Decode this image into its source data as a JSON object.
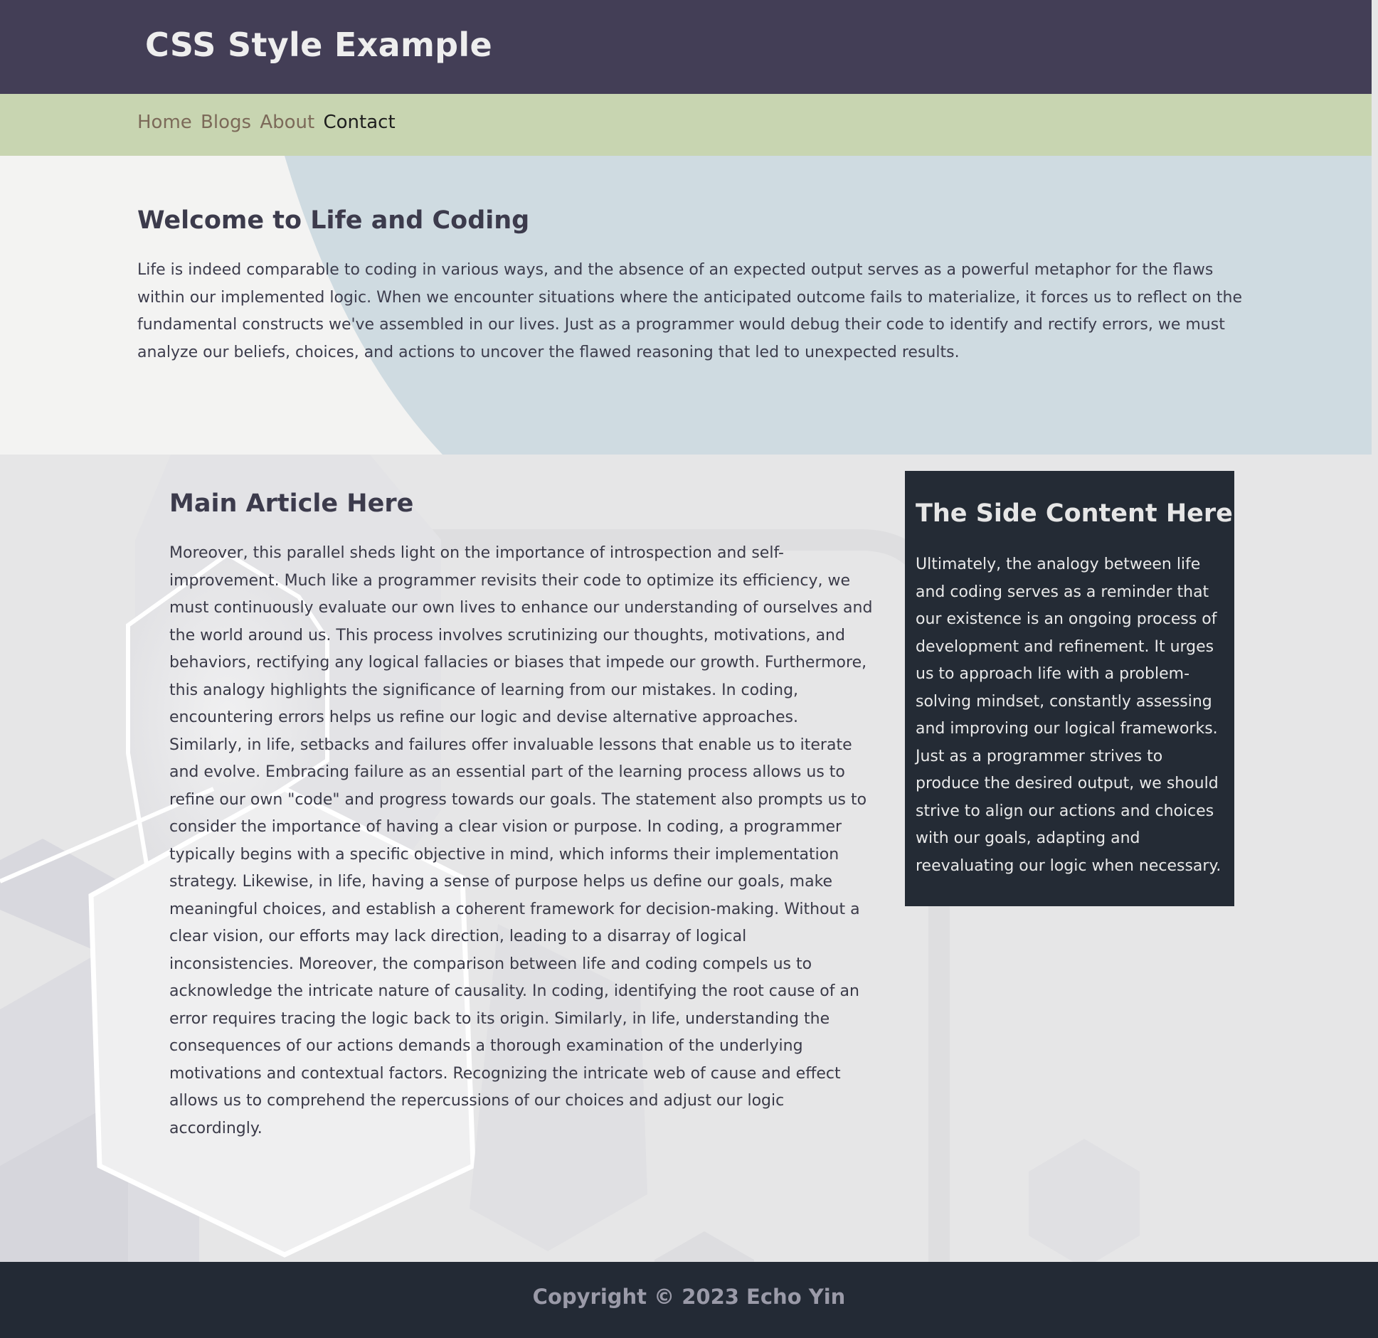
{
  "header": {
    "title": "CSS Style Example"
  },
  "nav": {
    "items": [
      "Home",
      "Blogs",
      "About",
      "Contact"
    ],
    "active": "Contact"
  },
  "hero": {
    "title": "Welcome to Life and Coding",
    "text": "Life is indeed comparable to coding in various ways, and the absence of an expected output serves as a powerful metaphor for the flaws within our implemented logic. When we encounter situations where the anticipated outcome fails to materialize, it forces us to reflect on the fundamental constructs we've assembled in our lives. Just as a programmer would debug their code to identify and rectify errors, we must analyze our beliefs, choices, and actions to uncover the flawed reasoning that led to unexpected results."
  },
  "main": {
    "title": "Main Article Here",
    "text": "Moreover, this parallel sheds light on the importance of introspection and self-improvement. Much like a programmer revisits their code to optimize its efficiency, we must continuously evaluate our own lives to enhance our understanding of ourselves and the world around us. This process involves scrutinizing our thoughts, motivations, and behaviors, rectifying any logical fallacies or biases that impede our growth. Furthermore, this analogy highlights the significance of learning from our mistakes. In coding, encountering errors helps us refine our logic and devise alternative approaches. Similarly, in life, setbacks and failures offer invaluable lessons that enable us to iterate and evolve. Embracing failure as an essential part of the learning process allows us to refine our own \"code\" and progress towards our goals. The statement also prompts us to consider the importance of having a clear vision or purpose. In coding, a programmer typically begins with a specific objective in mind, which informs their implementation strategy. Likewise, in life, having a sense of purpose helps us define our goals, make meaningful choices, and establish a coherent framework for decision-making. Without a clear vision, our efforts may lack direction, leading to a disarray of logical inconsistencies. Moreover, the comparison between life and coding compels us to acknowledge the intricate nature of causality. In coding, identifying the root cause of an error requires tracing the logic back to its origin. Similarly, in life, understanding the consequences of our actions demands a thorough examination of the underlying motivations and contextual factors. Recognizing the intricate web of cause and effect allows us to comprehend the repercussions of our choices and adjust our logic accordingly."
  },
  "aside": {
    "title": "The Side Content Here",
    "text": "Ultimately, the analogy between life and coding serves as a reminder that our existence is an ongoing process of development and refinement. It urges us to approach life with a problem-solving mindset, constantly assessing and improving our logical frameworks. Just as a programmer strives to produce the desired output, we should strive to align our actions and choices with our goals, adapting and reevaluating our logic when necessary."
  },
  "footer": {
    "copyright": "Copyright © 2023 Echo Yin"
  },
  "colors": {
    "header_bg": "#433e56",
    "nav_bg": "#c8d5b1",
    "nav_link": "#7c6a59",
    "nav_active": "#1e1e1e",
    "hero_left_bg": "#f3f3f2",
    "hero_right_bg": "#cfdbe1",
    "aside_bg": "#242b35",
    "footer_bg": "#232a35"
  }
}
